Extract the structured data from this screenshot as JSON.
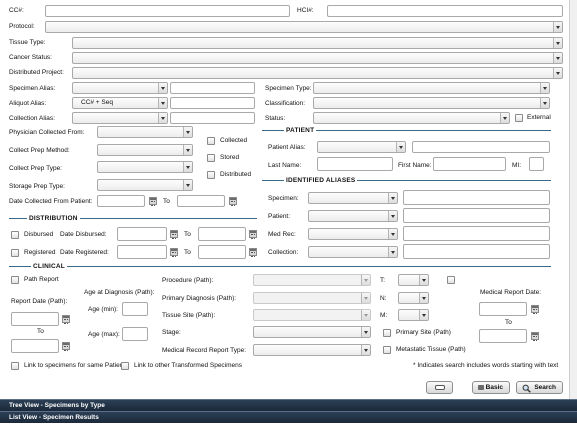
{
  "top": {
    "cc_label": "CC#:",
    "hci_label": "HCI#:",
    "protocol_label": "Protocol:",
    "tissue_type_label": "Tissue Type:",
    "cancer_status_label": "Cancer Status:",
    "distributed_project_label": "Distributed Project:"
  },
  "specimen": {
    "specimen_alias_label": "Specimen Alias:",
    "aliquot_alias_label": "Aliquot Alias:",
    "aliquot_alias_value": "CC# + Seq",
    "collection_alias_label": "Collection Alias:",
    "specimen_type_label": "Specimen Type:",
    "classification_label": "Classification:",
    "status_label": "Status:",
    "external_label": "External"
  },
  "collect": {
    "physician_label": "Physician Collected From:",
    "prep_method_label": "Collect Prep Method:",
    "prep_type_label": "Collect Prep Type:",
    "storage_prep_label": "Storage Prep Type:",
    "date_collected_label": "Date Collected From Patient:",
    "to_label": "To",
    "collected_label": "Collected",
    "stored_label": "Stored",
    "distributed_label": "Distributed"
  },
  "patient": {
    "section_title": "PATIENT",
    "patient_alias_label": "Patient Alias:",
    "last_name_label": "Last Name:",
    "first_name_label": "First Name:",
    "mi_label": "MI:"
  },
  "identified": {
    "section_title": "IDENTIFIED ALIASES",
    "specimen_label": "Specimen:",
    "patient_label": "Patient:",
    "med_rec_label": "Med Rec:",
    "collection_label": "Collection:"
  },
  "distribution": {
    "section_title": "DISTRIBUTION",
    "disbursed_label": "Disbursed",
    "date_disbursed_label": "Date Disbursed:",
    "registered_label": "Registered",
    "date_registered_label": "Date Registered:",
    "to_label": "To"
  },
  "clinical": {
    "section_title": "CLINICAL",
    "path_report_label": "Path Report",
    "report_date_label": "Report Date (Path):",
    "to_label": "To",
    "age_at_diag_label": "Age at Diagnosis (Path):",
    "age_min_label": "Age (min):",
    "age_max_label": "Age (max):",
    "procedure_label": "Procedure (Path):",
    "primary_diag_label": "Primary Diagnosis (Path):",
    "tissue_site_label": "Tissue Site (Path):",
    "stage_label": "Stage:",
    "med_record_type_label": "Medical Record Report Type:",
    "t_label": "T:",
    "n_label": "N:",
    "m_label": "M:",
    "primary_site_label": "Primary Site (Path)",
    "metastatic_label": "Metastatic Tissue (Path)",
    "medical_report_date_label": "Medical Report Date:",
    "link_same_patient_label": "Link to specimens for same Patient",
    "link_transformed_label": "Link to other Transformed Specimens",
    "note": "* Indicates search includes words starting with text"
  },
  "actions": {
    "basic_label": "Basic",
    "search_label": "Search"
  },
  "panels": {
    "tree_view": "Tree View - Specimens by Type",
    "list_view": "List View - Specimen Results"
  }
}
